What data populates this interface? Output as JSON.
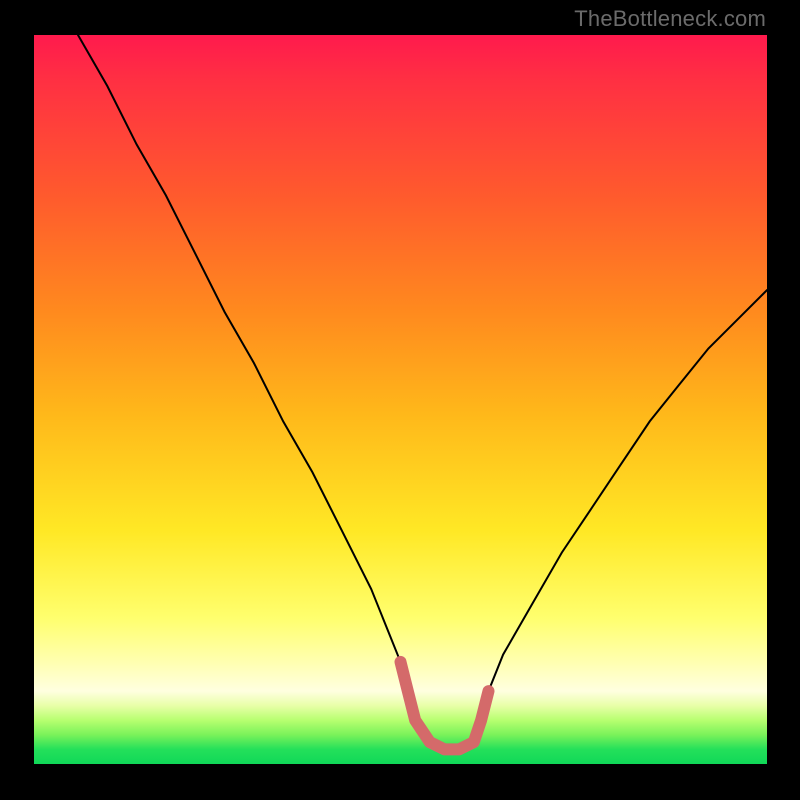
{
  "watermark": {
    "text": "TheBottleneck.com"
  },
  "chart_data": {
    "type": "line",
    "title": "",
    "xlabel": "",
    "ylabel": "",
    "xlim": [
      0,
      100
    ],
    "ylim": [
      0,
      100
    ],
    "grid": false,
    "legend": null,
    "series": [
      {
        "name": "bottleneck-curve",
        "x": [
          6,
          10,
          14,
          18,
          22,
          26,
          30,
          34,
          38,
          42,
          46,
          50,
          51,
          52,
          54,
          56,
          58,
          60,
          61,
          62,
          64,
          68,
          72,
          76,
          80,
          84,
          88,
          92,
          96,
          100
        ],
        "values": [
          100,
          93,
          85,
          78,
          70,
          62,
          55,
          47,
          40,
          32,
          24,
          14,
          10,
          6,
          3,
          2,
          2,
          3,
          6,
          10,
          15,
          22,
          29,
          35,
          41,
          47,
          52,
          57,
          61,
          65
        ],
        "color": "#000000",
        "stroke_width_px": 2
      },
      {
        "name": "optimal-range-marker",
        "x": [
          50,
          51,
          52,
          54,
          56,
          58,
          60,
          61,
          62
        ],
        "values": [
          14,
          10,
          6,
          3,
          2,
          2,
          3,
          6,
          10
        ],
        "color": "#d46a6a",
        "stroke_width_px": 12
      }
    ]
  }
}
